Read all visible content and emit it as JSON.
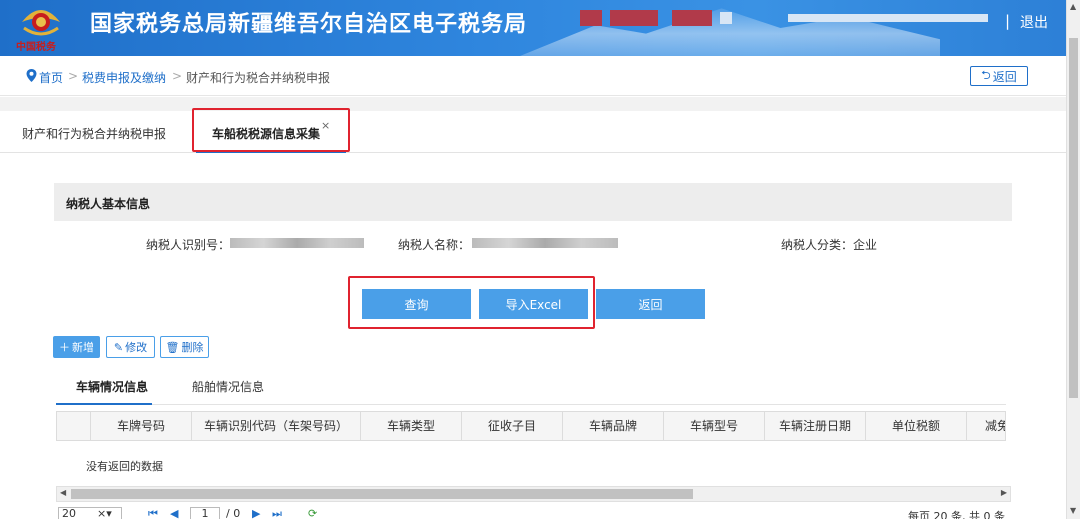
{
  "header": {
    "site_title": "国家税务总局新疆维吾尔自治区电子税务局",
    "emblem_text": "中国税务",
    "separator": "|",
    "logout": "退出"
  },
  "breadcrumb": {
    "home": "首页",
    "sep": ">",
    "level1": "税费申报及缴纳",
    "current": "财产和行为税合并纳税申报",
    "back": "返回"
  },
  "tabs": {
    "tab1": "财产和行为税合并纳税申报",
    "tab2": "车船税税源信息采集",
    "close": "×"
  },
  "taxpayer": {
    "panel_title": "纳税人基本信息",
    "id_label": "纳税人识别号：",
    "name_label": "纳税人名称：",
    "category_label": "纳税人分类：",
    "category_value": "企业"
  },
  "actions": {
    "query": "查询",
    "import_excel": "导入Excel",
    "back": "返回"
  },
  "toolbar": {
    "add": "新增",
    "edit": "修改",
    "delete": "删除"
  },
  "subtabs": {
    "vehicle": "车辆情况信息",
    "vessel": "船舶情况信息"
  },
  "table": {
    "columns": [
      "车牌号码",
      "车辆识别代码（车架号码）",
      "车辆类型",
      "征收子目",
      "车辆品牌",
      "车辆型号",
      "车辆注册日期",
      "单位税额",
      "减免性"
    ],
    "empty_message": "没有返回的数据"
  },
  "pager": {
    "page_size": "20",
    "current_page": "1",
    "total_pages": "/ 0",
    "summary": "每页 20 条, 共 0 条"
  },
  "colors": {
    "primary": "#1f6fc9",
    "button": "#4a9fe8",
    "highlight_box": "#e0232f"
  }
}
